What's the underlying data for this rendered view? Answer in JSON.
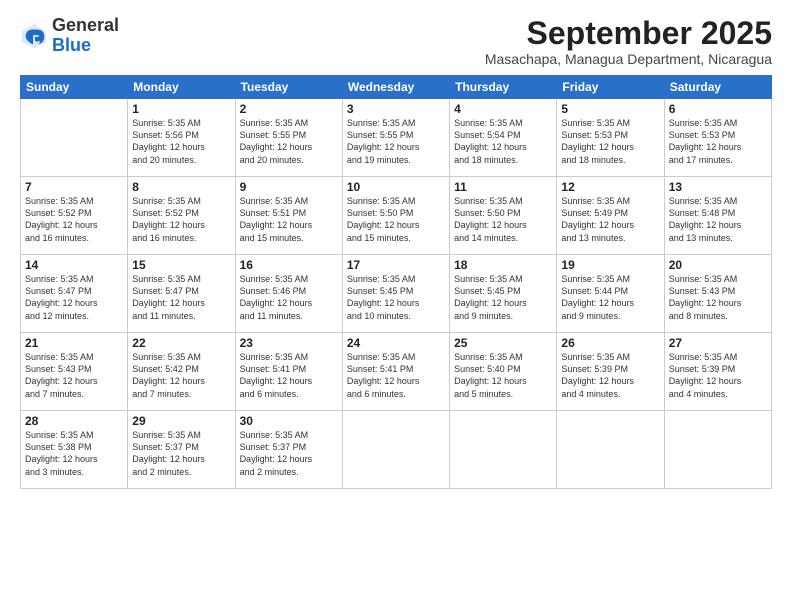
{
  "logo": {
    "general": "General",
    "blue": "Blue"
  },
  "header": {
    "month": "September 2025",
    "location": "Masachapa, Managua Department, Nicaragua"
  },
  "days": [
    "Sunday",
    "Monday",
    "Tuesday",
    "Wednesday",
    "Thursday",
    "Friday",
    "Saturday"
  ],
  "weeks": [
    [
      {
        "day": "",
        "content": ""
      },
      {
        "day": "1",
        "content": "Sunrise: 5:35 AM\nSunset: 5:56 PM\nDaylight: 12 hours\nand 20 minutes."
      },
      {
        "day": "2",
        "content": "Sunrise: 5:35 AM\nSunset: 5:55 PM\nDaylight: 12 hours\nand 20 minutes."
      },
      {
        "day": "3",
        "content": "Sunrise: 5:35 AM\nSunset: 5:55 PM\nDaylight: 12 hours\nand 19 minutes."
      },
      {
        "day": "4",
        "content": "Sunrise: 5:35 AM\nSunset: 5:54 PM\nDaylight: 12 hours\nand 18 minutes."
      },
      {
        "day": "5",
        "content": "Sunrise: 5:35 AM\nSunset: 5:53 PM\nDaylight: 12 hours\nand 18 minutes."
      },
      {
        "day": "6",
        "content": "Sunrise: 5:35 AM\nSunset: 5:53 PM\nDaylight: 12 hours\nand 17 minutes."
      }
    ],
    [
      {
        "day": "7",
        "content": "Sunrise: 5:35 AM\nSunset: 5:52 PM\nDaylight: 12 hours\nand 16 minutes."
      },
      {
        "day": "8",
        "content": "Sunrise: 5:35 AM\nSunset: 5:52 PM\nDaylight: 12 hours\nand 16 minutes."
      },
      {
        "day": "9",
        "content": "Sunrise: 5:35 AM\nSunset: 5:51 PM\nDaylight: 12 hours\nand 15 minutes."
      },
      {
        "day": "10",
        "content": "Sunrise: 5:35 AM\nSunset: 5:50 PM\nDaylight: 12 hours\nand 15 minutes."
      },
      {
        "day": "11",
        "content": "Sunrise: 5:35 AM\nSunset: 5:50 PM\nDaylight: 12 hours\nand 14 minutes."
      },
      {
        "day": "12",
        "content": "Sunrise: 5:35 AM\nSunset: 5:49 PM\nDaylight: 12 hours\nand 13 minutes."
      },
      {
        "day": "13",
        "content": "Sunrise: 5:35 AM\nSunset: 5:48 PM\nDaylight: 12 hours\nand 13 minutes."
      }
    ],
    [
      {
        "day": "14",
        "content": "Sunrise: 5:35 AM\nSunset: 5:47 PM\nDaylight: 12 hours\nand 12 minutes."
      },
      {
        "day": "15",
        "content": "Sunrise: 5:35 AM\nSunset: 5:47 PM\nDaylight: 12 hours\nand 11 minutes."
      },
      {
        "day": "16",
        "content": "Sunrise: 5:35 AM\nSunset: 5:46 PM\nDaylight: 12 hours\nand 11 minutes."
      },
      {
        "day": "17",
        "content": "Sunrise: 5:35 AM\nSunset: 5:45 PM\nDaylight: 12 hours\nand 10 minutes."
      },
      {
        "day": "18",
        "content": "Sunrise: 5:35 AM\nSunset: 5:45 PM\nDaylight: 12 hours\nand 9 minutes."
      },
      {
        "day": "19",
        "content": "Sunrise: 5:35 AM\nSunset: 5:44 PM\nDaylight: 12 hours\nand 9 minutes."
      },
      {
        "day": "20",
        "content": "Sunrise: 5:35 AM\nSunset: 5:43 PM\nDaylight: 12 hours\nand 8 minutes."
      }
    ],
    [
      {
        "day": "21",
        "content": "Sunrise: 5:35 AM\nSunset: 5:43 PM\nDaylight: 12 hours\nand 7 minutes."
      },
      {
        "day": "22",
        "content": "Sunrise: 5:35 AM\nSunset: 5:42 PM\nDaylight: 12 hours\nand 7 minutes."
      },
      {
        "day": "23",
        "content": "Sunrise: 5:35 AM\nSunset: 5:41 PM\nDaylight: 12 hours\nand 6 minutes."
      },
      {
        "day": "24",
        "content": "Sunrise: 5:35 AM\nSunset: 5:41 PM\nDaylight: 12 hours\nand 6 minutes."
      },
      {
        "day": "25",
        "content": "Sunrise: 5:35 AM\nSunset: 5:40 PM\nDaylight: 12 hours\nand 5 minutes."
      },
      {
        "day": "26",
        "content": "Sunrise: 5:35 AM\nSunset: 5:39 PM\nDaylight: 12 hours\nand 4 minutes."
      },
      {
        "day": "27",
        "content": "Sunrise: 5:35 AM\nSunset: 5:39 PM\nDaylight: 12 hours\nand 4 minutes."
      }
    ],
    [
      {
        "day": "28",
        "content": "Sunrise: 5:35 AM\nSunset: 5:38 PM\nDaylight: 12 hours\nand 3 minutes."
      },
      {
        "day": "29",
        "content": "Sunrise: 5:35 AM\nSunset: 5:37 PM\nDaylight: 12 hours\nand 2 minutes."
      },
      {
        "day": "30",
        "content": "Sunrise: 5:35 AM\nSunset: 5:37 PM\nDaylight: 12 hours\nand 2 minutes."
      },
      {
        "day": "",
        "content": ""
      },
      {
        "day": "",
        "content": ""
      },
      {
        "day": "",
        "content": ""
      },
      {
        "day": "",
        "content": ""
      }
    ]
  ]
}
